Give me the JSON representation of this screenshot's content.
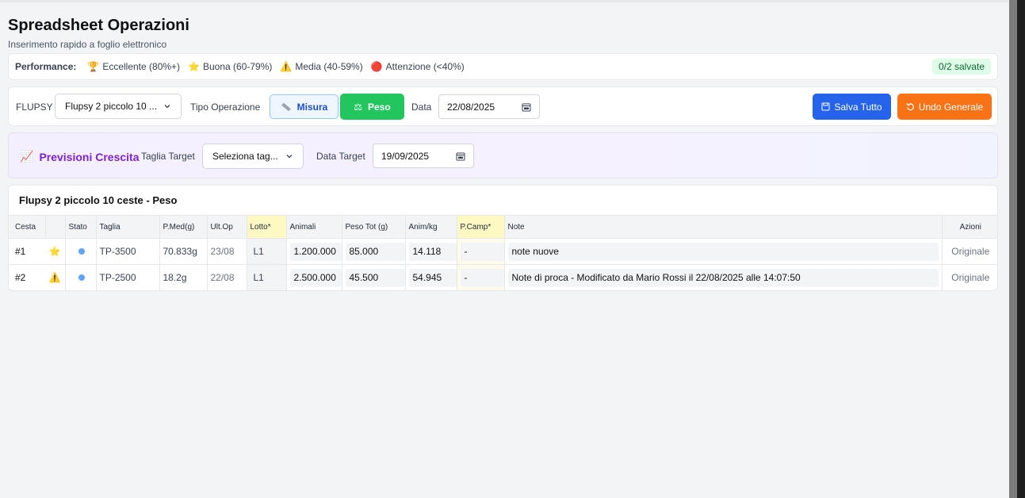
{
  "page": {
    "title": "Spreadsheet Operazioni",
    "subtitle": "Inserimento rapido a foglio elettronico"
  },
  "performance": {
    "label": "Performance:",
    "items": [
      {
        "icon": "trophy-icon",
        "glyph": "🏆",
        "text": "Eccellente (80%+)"
      },
      {
        "icon": "star-icon",
        "glyph": "⭐",
        "text": "Buona (60-79%)"
      },
      {
        "icon": "warning-icon",
        "glyph": "⚠️",
        "text": "Media (40-59%)"
      },
      {
        "icon": "red-circle-icon",
        "glyph": "🔴",
        "text": "Attenzione (<40%)"
      }
    ],
    "saved_badge": "0/2 salvate"
  },
  "toolbar": {
    "flupsy_label": "FLUPSY",
    "flupsy_value": "Flupsy 2 piccolo 10 ...",
    "tipo_label": "Tipo Operazione",
    "misura_label": "Misura",
    "peso_label": "Peso",
    "data_label": "Data",
    "data_value": "22/08/2025",
    "salva_label": "Salva Tutto",
    "undo_label": "Undo Generale"
  },
  "forecast": {
    "title": "Previsioni Crescita",
    "taglia_label": "Taglia Target",
    "taglia_value": "Seleziona tag...",
    "data_label": "Data Target",
    "data_value": "19/09/2025"
  },
  "table": {
    "title": "Flupsy 2 piccolo 10 ceste - Peso",
    "headers": {
      "cesta": "Cesta",
      "stato": "Stato",
      "taglia": "Taglia",
      "pmed": "P.Med(g)",
      "ultop": "Ult.Op",
      "lotto": "Lotto*",
      "animali": "Animali",
      "pesotot": "Peso Tot (g)",
      "animkg": "Anim/kg",
      "pcamp": "P.Camp*",
      "note": "Note",
      "azioni": "Azioni"
    },
    "rows": [
      {
        "cesta": "#1",
        "icon": "star-icon",
        "glyph": "⭐",
        "taglia": "TP-3500",
        "pmed": "70.833g",
        "ultop": "23/08",
        "lotto": "L1",
        "animali": "1.200.000",
        "pesotot": "85.000",
        "animkg": "14.118",
        "pcamp": "-",
        "note": "note nuove",
        "azioni": "Originale"
      },
      {
        "cesta": "#2",
        "icon": "warning-icon",
        "glyph": "⚠️",
        "taglia": "TP-2500",
        "pmed": "18.2g",
        "ultop": "22/08",
        "lotto": "L1",
        "animali": "2.500.000",
        "pesotot": "45.500",
        "animkg": "54.945",
        "pcamp": "-",
        "note": "Note di proca - Modificato da Mario Rossi il 22/08/2025 alle 14:07:50",
        "azioni": "Originale"
      }
    ]
  },
  "colors": {
    "primary": "#2563eb",
    "success": "#22c55e",
    "orange": "#f97316",
    "purple": "#7e22ce"
  }
}
